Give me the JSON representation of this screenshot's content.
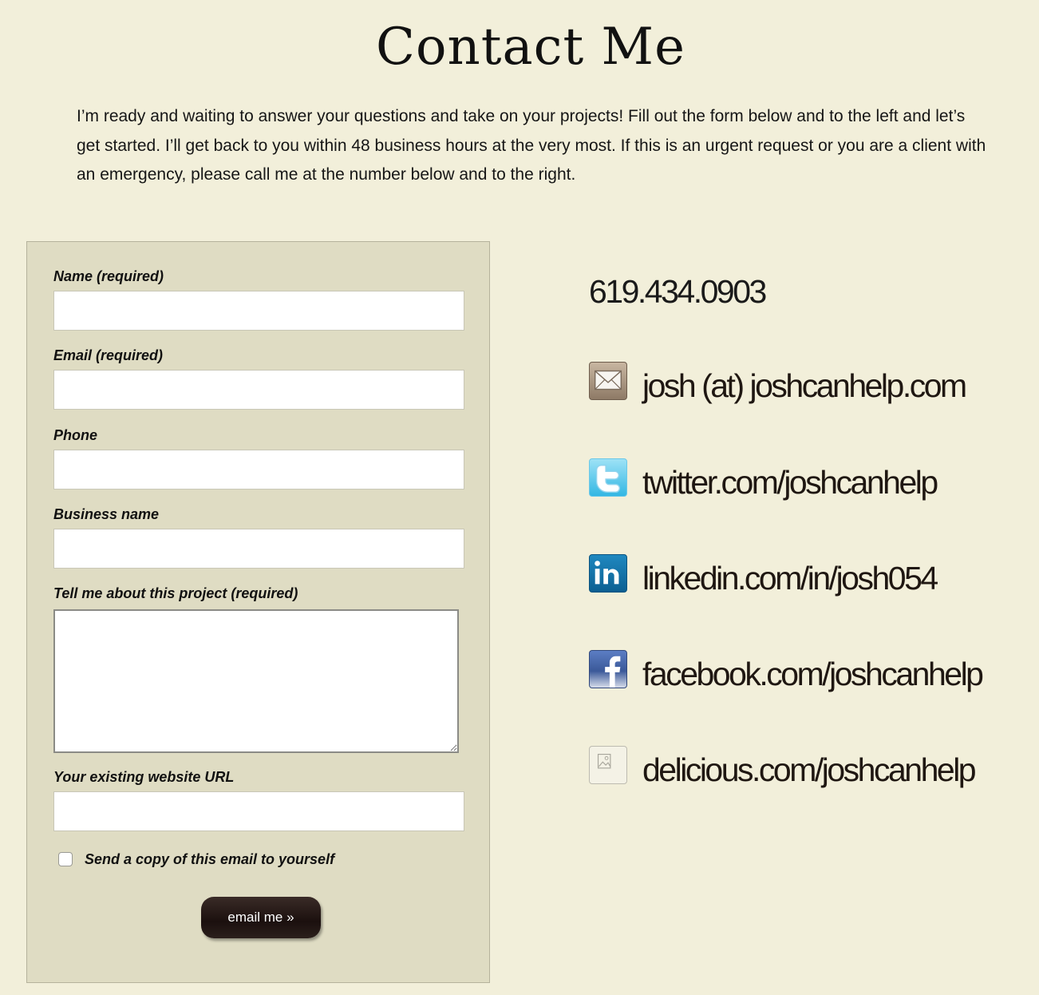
{
  "page": {
    "title": "Contact Me",
    "intro": "I’m ready and waiting to answer your questions and take on your projects! Fill out the form below and to the left and let’s get started. I’ll get back to you within 48 business hours at the very most. If this is an urgent request or you are a client with an emergency, please call me at the number below and to the right."
  },
  "form": {
    "fields": {
      "name": {
        "label": "Name (required)",
        "value": ""
      },
      "email": {
        "label": "Email (required)",
        "value": ""
      },
      "phone": {
        "label": "Phone",
        "value": ""
      },
      "business": {
        "label": "Business name",
        "value": ""
      },
      "project": {
        "label": "Tell me about this project (required)",
        "value": ""
      },
      "website": {
        "label": "Your existing website URL",
        "value": ""
      }
    },
    "copy_checkbox_label": "Send a copy of this email to yourself",
    "copy_checked": false,
    "submit_label": "email me »"
  },
  "contact": {
    "phone": "619.434.0903",
    "items": [
      {
        "icon": "mail-icon",
        "text": "josh (at) joshcanhelp.com"
      },
      {
        "icon": "twitter-icon",
        "text": "twitter.com/joshcanhelp"
      },
      {
        "icon": "linkedin-icon",
        "text": "linkedin.com/in/josh054"
      },
      {
        "icon": "facebook-icon",
        "text": "facebook.com/joshcanhelp"
      },
      {
        "icon": "delicious-icon",
        "text": "delicious.com/joshcanhelp"
      }
    ]
  },
  "colors": {
    "page_background": "#f2efda",
    "form_background": "#dfdcc3",
    "button_background": "#1b100e",
    "contact_text": "#1f1712"
  }
}
